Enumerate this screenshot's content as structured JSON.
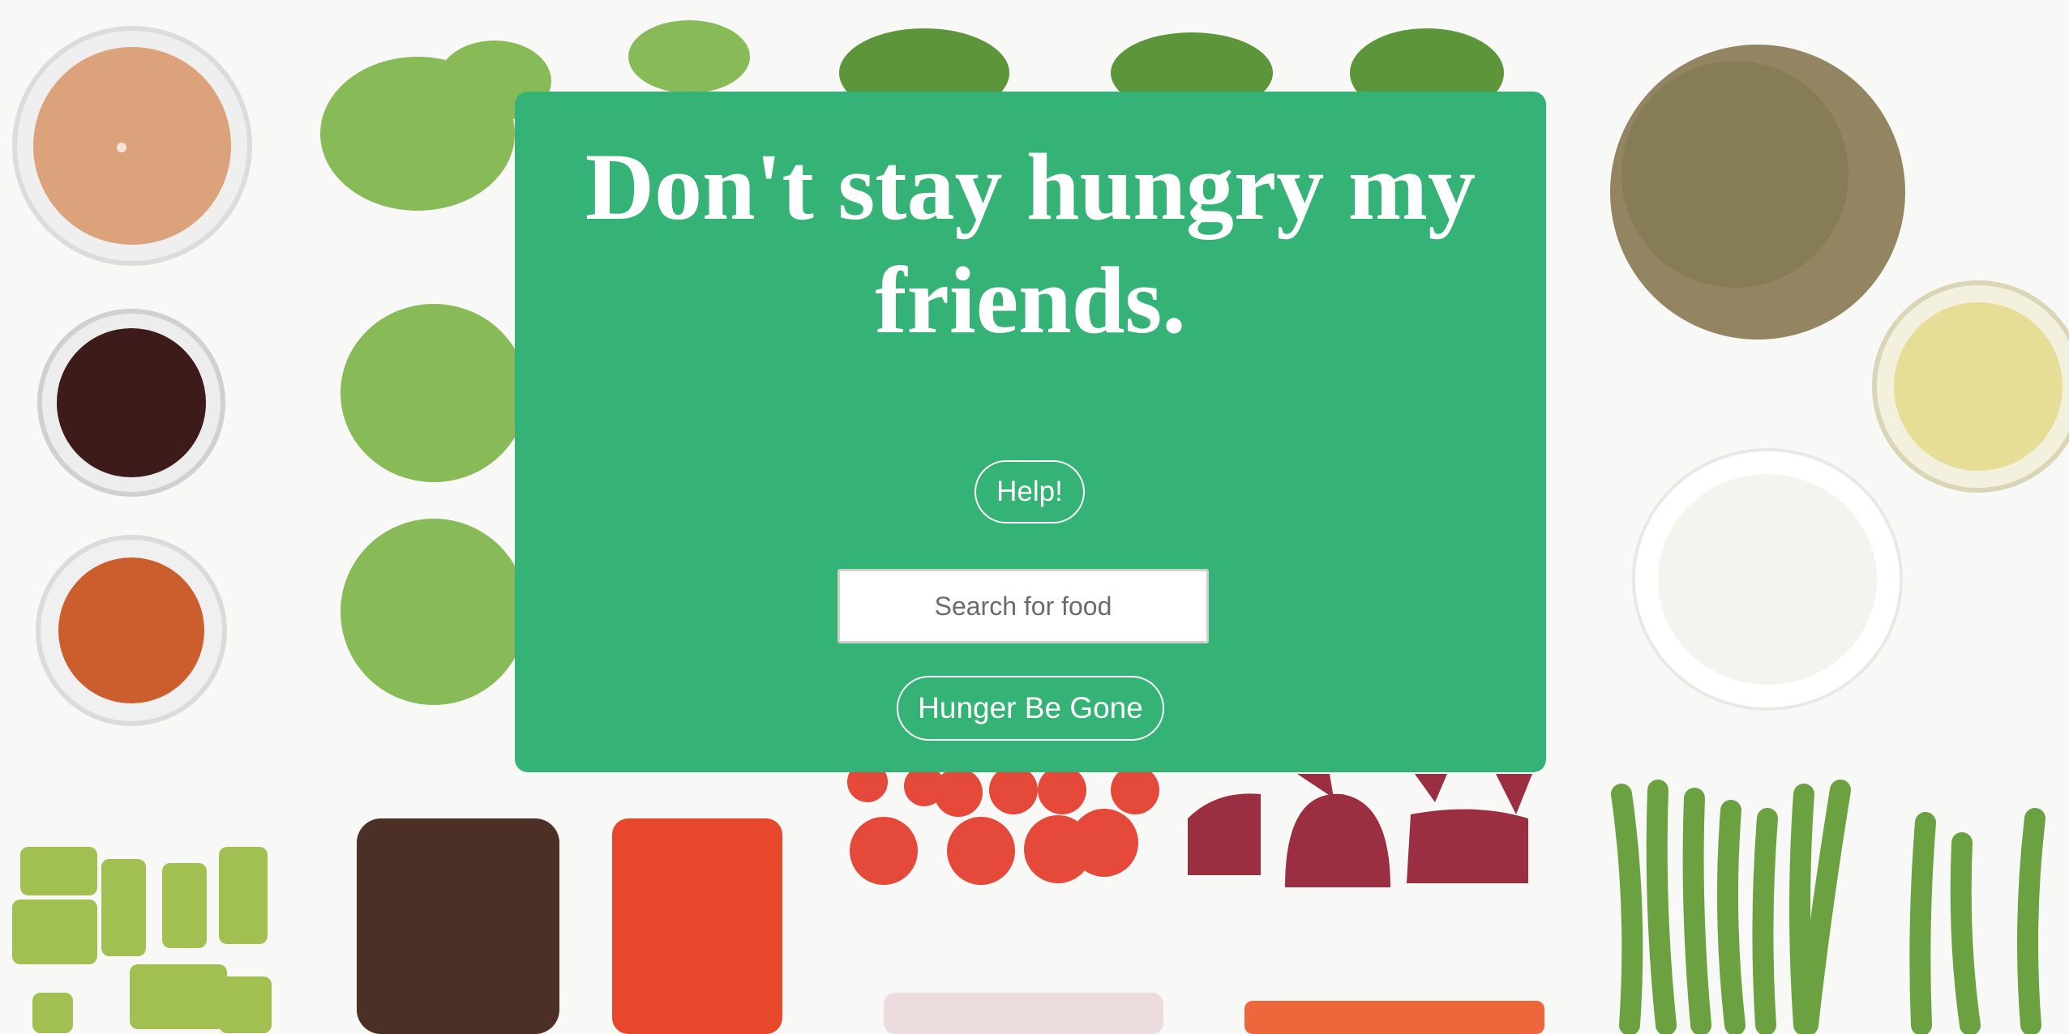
{
  "theme": {
    "card_color": "#35b376",
    "text_color": "#ffffff"
  },
  "hero": {
    "headline": "Don't stay hungry my friends."
  },
  "actions": {
    "help_label": "Help!",
    "search_placeholder": "Search for food",
    "search_value": "",
    "submit_label": "Hunger Be Gone"
  },
  "background": {
    "description_icons": [
      "dressing-bowl",
      "kale",
      "spinach-leaf",
      "lentils",
      "soy-sauce-bowl",
      "olive-oil-bowl",
      "vinegar-bowl",
      "feta-cheese",
      "avocado",
      "black-beans",
      "red-pepper",
      "cherry-tomatoes",
      "beets",
      "green-beans",
      "onion"
    ]
  }
}
